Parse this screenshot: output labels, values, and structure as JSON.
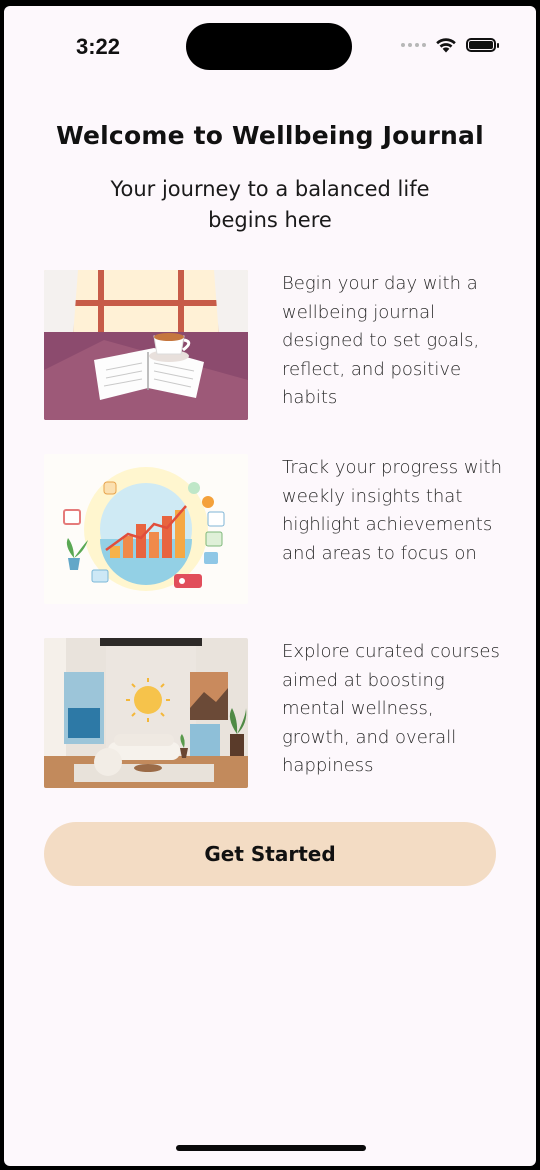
{
  "status_bar": {
    "time": "3:22"
  },
  "header": {
    "title": "Welcome to Wellbeing Journal",
    "subtitle": "Your journey to a balanced life begins here"
  },
  "features": [
    {
      "image": "journal-coffee-illustration",
      "text": "Begin your day with a wellbeing journal designed to set goals, reflect, and positive habits"
    },
    {
      "image": "progress-chart-illustration",
      "text": "Track your progress with weekly insights that highlight achievements and areas to focus on"
    },
    {
      "image": "wellness-room-illustration",
      "text": "Explore curated courses aimed at boosting mental wellness, growth, and overall happiness"
    }
  ],
  "cta": {
    "label": "Get Started",
    "color": "#f3dcc4"
  },
  "colors": {
    "background": "#fdf8fc",
    "text": "#111111"
  }
}
